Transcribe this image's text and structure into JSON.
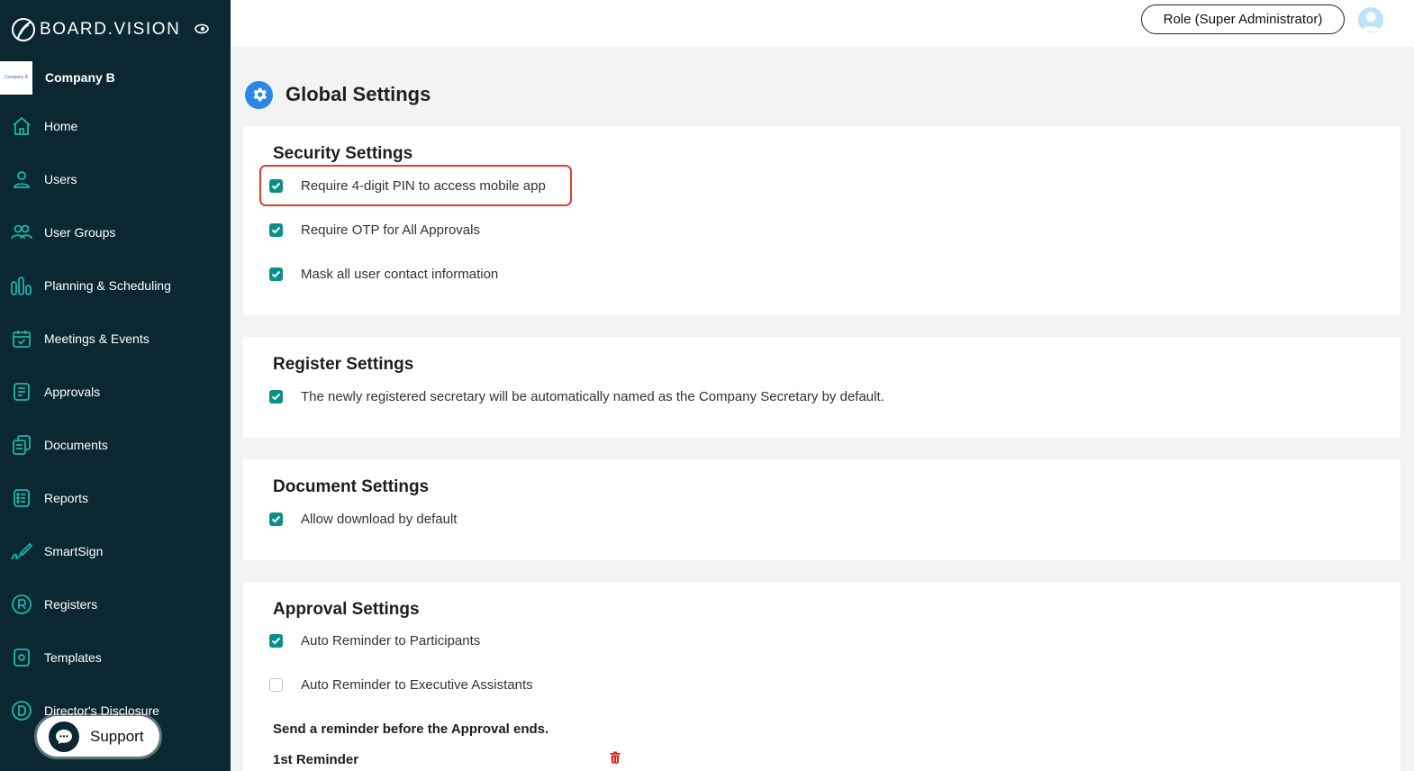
{
  "brand": {
    "name": "BOARD.VISION",
    "logo_icon": "swirl-logo-icon",
    "toggle_icon": "eye-toggle-icon"
  },
  "company": {
    "name": "Company B",
    "logo_text": "Company B"
  },
  "sidebar": {
    "items": [
      {
        "label": "Home",
        "icon": "home-icon"
      },
      {
        "label": "Users",
        "icon": "user-icon"
      },
      {
        "label": "User Groups",
        "icon": "user-groups-icon"
      },
      {
        "label": "Planning & Scheduling",
        "icon": "planning-icon"
      },
      {
        "label": "Meetings & Events",
        "icon": "calendar-icon"
      },
      {
        "label": "Approvals",
        "icon": "approvals-icon"
      },
      {
        "label": "Documents",
        "icon": "documents-icon"
      },
      {
        "label": "Reports",
        "icon": "reports-icon"
      },
      {
        "label": "SmartSign",
        "icon": "signature-icon"
      },
      {
        "label": "Registers",
        "icon": "registered-icon"
      },
      {
        "label": "Templates",
        "icon": "templates-icon"
      },
      {
        "label": "Director's Disclosure",
        "icon": "disclosure-icon"
      }
    ]
  },
  "support": {
    "label": "Support",
    "icon": "chat-bubble-icon"
  },
  "header": {
    "role_label": "Role (Super Administrator)",
    "avatar_icon": "user-avatar-icon"
  },
  "page": {
    "title": "Global Settings",
    "icon": "gear-icon"
  },
  "sections": {
    "security": {
      "title": "Security Settings",
      "options": [
        {
          "label": "Require 4-digit PIN to access mobile app",
          "checked": true
        },
        {
          "label": "Require OTP for All Approvals",
          "checked": true
        },
        {
          "label": "Mask all user contact information",
          "checked": true
        }
      ]
    },
    "register": {
      "title": "Register Settings",
      "options": [
        {
          "label": "The newly registered secretary will be automatically named as the Company Secretary by default.",
          "checked": true
        }
      ]
    },
    "document": {
      "title": "Document Settings",
      "options": [
        {
          "label": "Allow download by default",
          "checked": true
        }
      ]
    },
    "approval": {
      "title": "Approval Settings",
      "options": [
        {
          "label": "Auto Reminder to Participants",
          "checked": true
        },
        {
          "label": "Auto Reminder to Executive Assistants",
          "checked": false
        }
      ],
      "reminder_heading": "Send a reminder before the Approval ends.",
      "reminder_label": "1st Reminder",
      "delete_icon": "trash-icon"
    }
  },
  "colors": {
    "sidebar_bg": "#0b2832",
    "checkbox_checked": "#0b8f89",
    "highlight_border": "#d9412e",
    "page_icon": "#2a86e8",
    "delete_icon": "#e02020"
  }
}
